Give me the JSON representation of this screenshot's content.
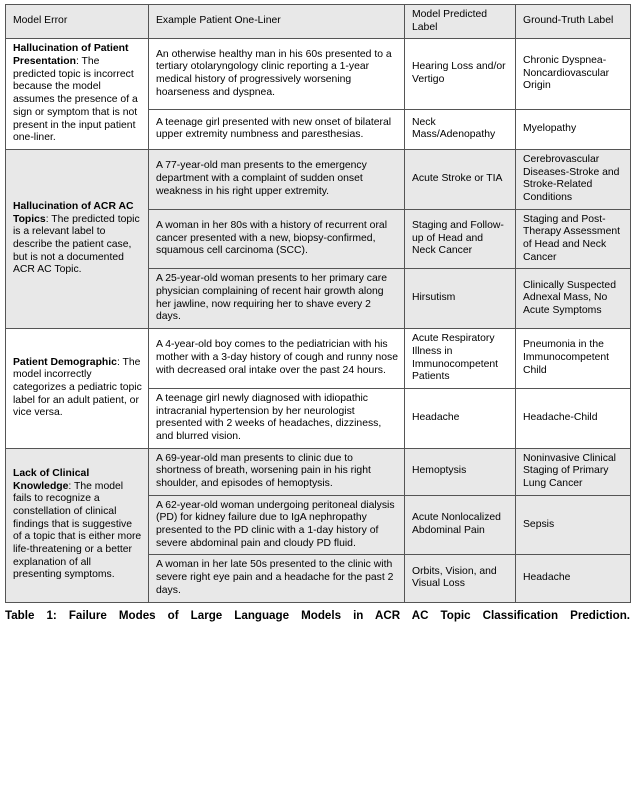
{
  "table": {
    "headers": [
      "Model Error",
      "Example Patient One-Liner",
      "Model Predicted Label",
      "Ground-Truth Label"
    ],
    "groups": [
      {
        "shaded": false,
        "error_title": "Hallucination of Patient Presentation",
        "error_body": ": The predicted topic is incorrect because the model assumes the presence of a sign or symptom that is not present in the input patient one-liner.",
        "rows": [
          {
            "one_liner": "An otherwise healthy man in his 60s presented to a tertiary otolaryngology clinic reporting a 1-year medical history of progressively worsening hoarseness and dyspnea.",
            "predicted": "Hearing Loss and/or Vertigo",
            "truth": "Chronic Dyspnea-Noncardiovascular Origin"
          },
          {
            "one_liner": "A teenage girl presented with new onset of bilateral upper extremity numbness and paresthesias.",
            "predicted": "Neck Mass/Adenopathy",
            "truth": "Myelopathy"
          }
        ]
      },
      {
        "shaded": true,
        "error_title": "Hallucination of ACR AC Topics",
        "error_body": ": The predicted topic is a relevant label to describe the patient case, but is not a documented ACR AC Topic.",
        "rows": [
          {
            "one_liner": "A 77-year-old man presents to the emergency department with a complaint of sudden onset weakness in his right upper extremity.",
            "predicted": "Acute Stroke or TIA",
            "truth": "Cerebrovascular Diseases-Stroke and Stroke-Related Conditions"
          },
          {
            "one_liner": "A woman in her 80s with a history of recurrent oral cancer presented with a new, biopsy-confirmed, squamous cell carcinoma (SCC).",
            "predicted": "Staging and Follow-up of Head and Neck Cancer",
            "truth": "Staging and Post-Therapy Assessment of Head and Neck Cancer"
          },
          {
            "one_liner": "A 25-year-old woman presents to her primary care physician complaining of recent hair growth along her jawline, now requiring her to shave every 2 days.",
            "predicted": "Hirsutism",
            "truth": "Clinically Suspected Adnexal Mass, No Acute Symptoms"
          }
        ]
      },
      {
        "shaded": false,
        "error_title": "Patient Demographic",
        "error_body": ": The model incorrectly categorizes a pediatric topic label for an adult patient, or vice versa.",
        "rows": [
          {
            "one_liner": "A 4-year-old boy comes to the pediatrician with his mother with a 3-day history of cough and runny nose with decreased oral intake over the past 24 hours.",
            "predicted": "Acute Respiratory Illness in Immunocompetent Patients",
            "truth": "Pneumonia in the Immunocompetent Child"
          },
          {
            "one_liner": "A teenage girl newly diagnosed with idiopathic intracranial hypertension by her neurologist presented with 2 weeks of headaches, dizziness, and blurred vision.",
            "predicted": "Headache",
            "truth": "Headache-Child"
          }
        ]
      },
      {
        "shaded": true,
        "error_title": "Lack of Clinical Knowledge",
        "error_body": ": The model fails to recognize a constellation of clinical findings that is suggestive of a topic that is either more life-threatening or a better explanation of all presenting symptoms.",
        "rows": [
          {
            "one_liner": "A 69-year-old man presents to clinic due to shortness of breath, worsening pain in his right shoulder, and episodes of hemoptysis.",
            "predicted": "Hemoptysis",
            "truth": "Noninvasive Clinical Staging of Primary Lung Cancer"
          },
          {
            "one_liner": "A 62-year-old woman undergoing peritoneal dialysis (PD) for kidney failure due to IgA nephropathy presented to the PD clinic with a 1-day history of severe abdominal pain and cloudy PD fluid.",
            "predicted": "Acute Nonlocalized Abdominal Pain",
            "truth": "Sepsis"
          },
          {
            "one_liner": "A woman in her late 50s presented to the clinic with severe right eye pain and a headache for the past 2 days.",
            "predicted": "Orbits, Vision, and Visual Loss",
            "truth": "Headache"
          }
        ]
      }
    ]
  },
  "caption": {
    "line1": "Table 1: Failure Modes of Large Language Models in ACR AC Topic Classification Prediction."
  }
}
